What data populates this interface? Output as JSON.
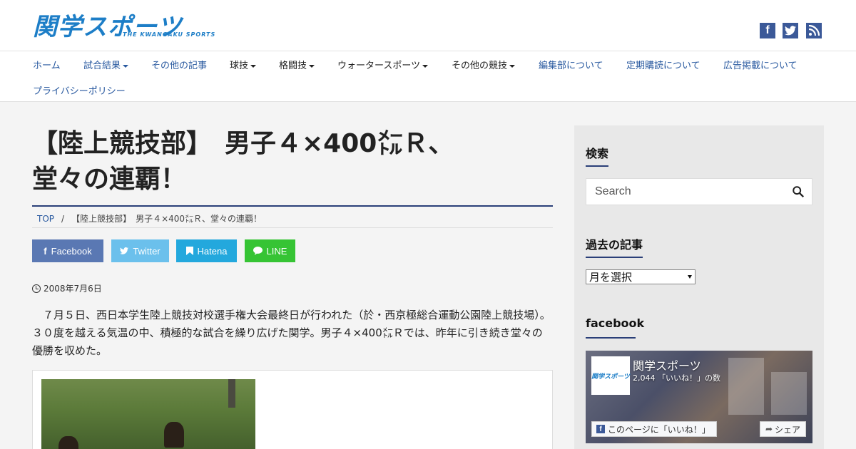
{
  "header": {
    "logo_text": "関学スポーツ",
    "logo_sub": "THE KWANGAKU SPORTS",
    "social": [
      {
        "icon": "facebook-icon",
        "glyph": "f"
      },
      {
        "icon": "twitter-icon"
      },
      {
        "icon": "rss-icon"
      }
    ]
  },
  "nav": {
    "items": [
      {
        "label": "ホーム"
      },
      {
        "label": "試合結果"
      },
      {
        "label": "その他の記事"
      },
      {
        "label": "球技"
      },
      {
        "label": "格闘技"
      },
      {
        "label": "ウォータースポーツ"
      },
      {
        "label": "その他の競技"
      },
      {
        "label": "編集部について"
      },
      {
        "label": "定期購読について"
      },
      {
        "label": "広告掲載について"
      },
      {
        "label": "プライバシーポリシー"
      }
    ]
  },
  "article": {
    "title_line1": "【陸上競技部】　男子４×400㍍Ｒ、",
    "title_line2": "堂々の連覇！",
    "breadcrumb": {
      "top": "TOP",
      "separator": "/",
      "current": "【陸上競技部】　男子４×400㍍Ｒ、堂々の連覇！"
    },
    "share": {
      "facebook": {
        "label": "Facebook",
        "glyph": "f"
      },
      "twitter": {
        "label": "Twitter"
      },
      "hatena": {
        "label": "Hatena"
      },
      "line": {
        "label": "LINE"
      }
    },
    "date": "2008年7月6日",
    "body": "　７月５日、西日本学生陸上競技対校選手権大会最終日が行われた（於・西京極総合運動公園陸上競技場）。３０度を越える気温の中、積極的な試合を繰り広げた関学。男子４×400㍍Ｒでは、昨年に引き続き堂々の優勝を収めた。"
  },
  "sidebar": {
    "search": {
      "title": "検索",
      "placeholder": "Search"
    },
    "archive": {
      "title": "過去の記事",
      "selected": "月を選択"
    },
    "facebook": {
      "title": "facebook",
      "page_name": "関学スポーツ",
      "thumb_text": "関学スポーツ",
      "likes": "2,044 「いいね！」の数",
      "like_button": "このページに「いいね！」",
      "share_button": "シェア"
    }
  },
  "colors": {
    "brand": "#1d7ec7",
    "accent_rule": "#2a3f78",
    "nav_link": "#2a5aa0",
    "facebook": "#5a78b3",
    "twitter": "#6bc0ec",
    "hatena": "#23a8dd",
    "line": "#36c434"
  }
}
